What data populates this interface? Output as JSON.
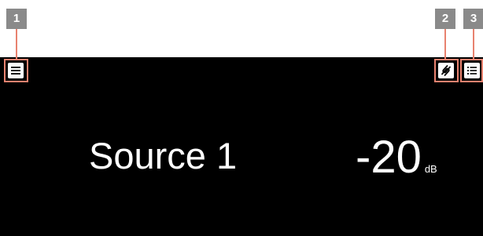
{
  "callouts": [
    {
      "label": "1"
    },
    {
      "label": "2"
    },
    {
      "label": "3"
    }
  ],
  "toolbar": {
    "menu_icon": "hamburger-menu-icon",
    "link_icon": "link-icon",
    "list_icon": "list-icon"
  },
  "display": {
    "source_name": "Source 1",
    "volume_value": "-20",
    "volume_unit": "dB"
  },
  "colors": {
    "screen_background": "#000000",
    "callout_accent": "#e8826f",
    "badge_background": "#8a8a8a"
  }
}
